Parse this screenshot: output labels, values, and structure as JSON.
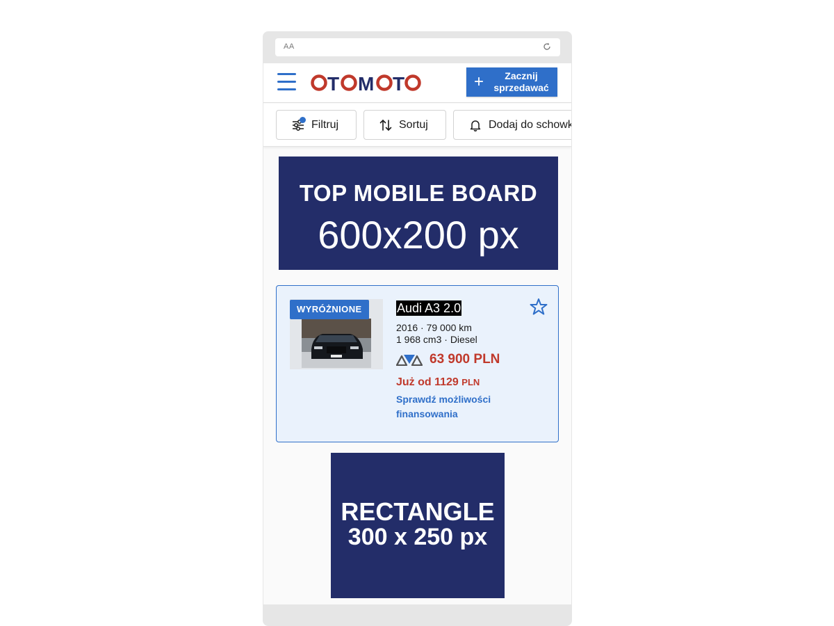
{
  "browser": {
    "aa_label": "AA"
  },
  "header": {
    "logo_text": "OTOMOTO",
    "sell_label_line1": "Zacznij",
    "sell_label_line2": "sprzedawać",
    "accent_color": "#2f6fc9",
    "logo_red": "#c0392b",
    "logo_navy": "#232d69"
  },
  "toolbar": {
    "filter_label": "Filtruj",
    "sort_label": "Sortuj",
    "save_label": "Dodaj do schowka"
  },
  "ads": {
    "top_line1": "TOP MOBILE BOARD",
    "top_line2": "600x200 px",
    "rect_line1": "RECTANGLE",
    "rect_line2": "300 x 250 px",
    "ad_color": "#232d69"
  },
  "listing": {
    "badge": "WYRÓŻNIONE",
    "title": "Audi A3 2.0",
    "spec_line1": "2016 · 79 000 km",
    "spec_line2": "1 968 cm3 · Diesel",
    "price": "63 900 PLN",
    "finance_prefix": "Już od 1129",
    "finance_currency": "PLN",
    "finance_link": "Sprawdź możliwości finansowania",
    "price_color": "#c0392b"
  }
}
